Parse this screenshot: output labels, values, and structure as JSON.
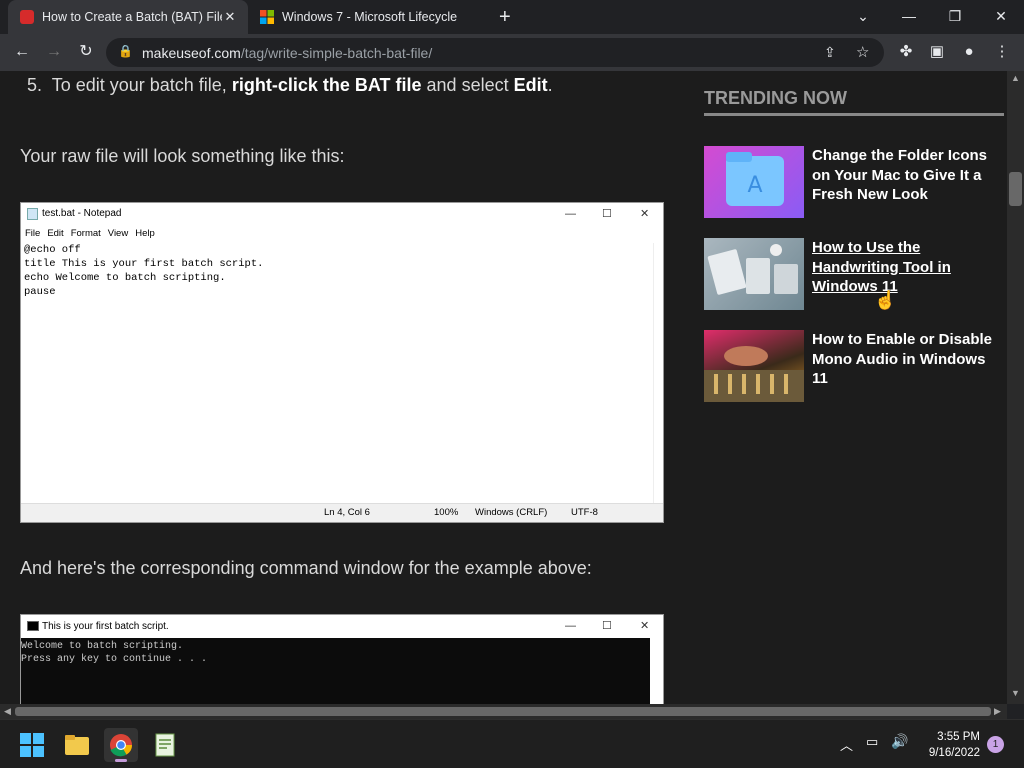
{
  "tabs": [
    {
      "title": "How to Create a Batch (BAT) File",
      "favicon": "muo-icon",
      "active": true
    },
    {
      "title": "Windows 7 - Microsoft Lifecycle",
      "favicon": "microsoft-icon",
      "active": false
    }
  ],
  "address": {
    "host": "makeuseof.com",
    "path": "/tag/write-simple-batch-bat-file/"
  },
  "article": {
    "step_number": "5.",
    "step_text_1": "To edit your batch file,",
    "step_bold_1": "right-click the BAT file",
    "step_text_2": "and select",
    "step_bold_2": "Edit",
    "step_end": ".",
    "para_raw": "Your raw file will look something like this:",
    "para_cmd": "And here's the corresponding command window for the example above:"
  },
  "notepad": {
    "title": "test.bat - Notepad",
    "menu": [
      "File",
      "Edit",
      "Format",
      "View",
      "Help"
    ],
    "lines": [
      "@echo off",
      "title This is your first batch script.",
      "echo Welcome to batch scripting.",
      "pause"
    ],
    "status_pos": "Ln 4, Col 6",
    "status_zoom": "100%",
    "status_eol": "Windows (CRLF)",
    "status_enc": "UTF-8"
  },
  "cmd": {
    "title": "This is your first batch script.",
    "lines": [
      "Welcome to batch scripting.",
      "Press any key to continue . . ."
    ]
  },
  "sidebar": {
    "heading": "TRENDING NOW",
    "items": [
      {
        "title": "Change the Folder Icons on Your Mac to Give It a Fresh New Look"
      },
      {
        "title": "How to Use the Handwriting Tool in Windows 11"
      },
      {
        "title": "How to Enable or Disable Mono Audio in Windows 11"
      }
    ]
  },
  "taskbar": {
    "time": "3:55 PM",
    "date": "9/16/2022",
    "notification_count": "1"
  }
}
